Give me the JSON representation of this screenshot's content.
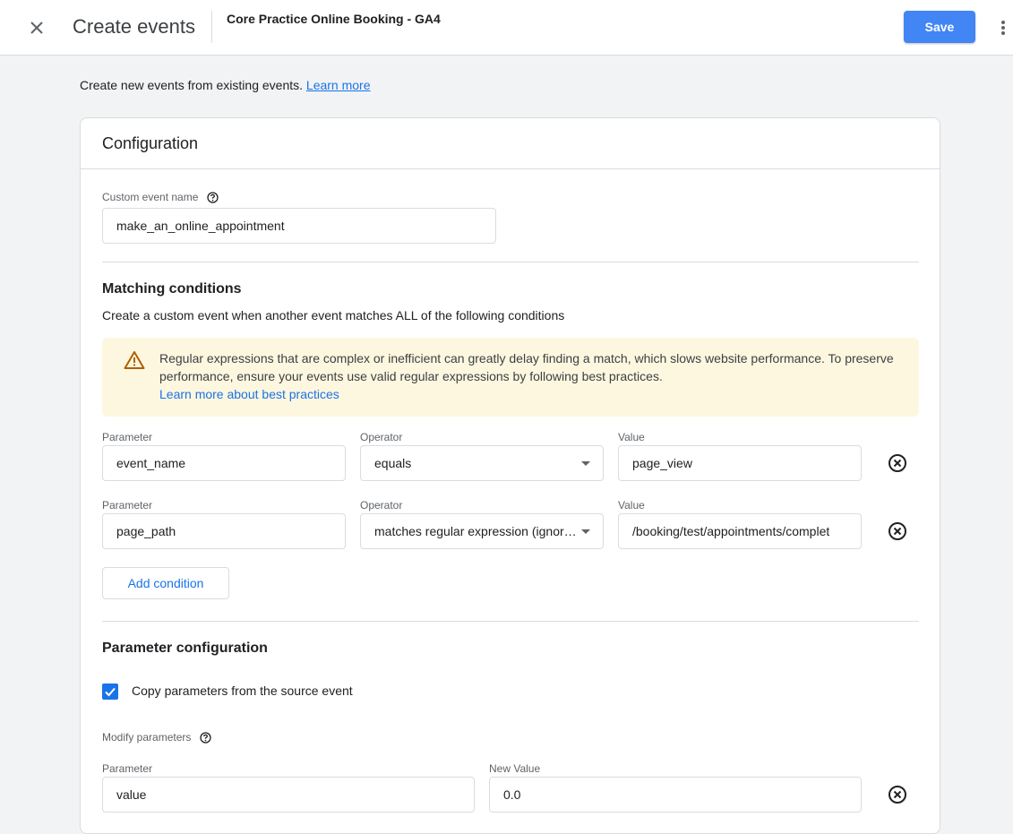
{
  "header": {
    "title": "Create events",
    "property": "Core Practice Online Booking - GA4",
    "save_label": "Save"
  },
  "intro": {
    "text": "Create new events from existing events.",
    "link": "Learn more"
  },
  "configuration": {
    "title": "Configuration",
    "custom_event_name_label": "Custom event name",
    "custom_event_name_value": "make_an_online_appointment"
  },
  "matching": {
    "title": "Matching conditions",
    "description": "Create a custom event when another event matches ALL of the following conditions",
    "warning_text": "Regular expressions that are complex or inefficient can greatly delay finding a match, which slows website performance. To preserve performance, ensure your events use valid regular expressions by following best practices.",
    "warning_link": "Learn more about best practices",
    "conditions": [
      {
        "parameter_label": "Parameter",
        "parameter": "event_name",
        "operator_label": "Operator",
        "operator": "equals",
        "value_label": "Value",
        "value": "page_view"
      },
      {
        "parameter_label": "Parameter",
        "parameter": "page_path",
        "operator_label": "Operator",
        "operator": "matches regular expression (ignore case)",
        "value_label": "Value",
        "value": "/booking/test/appointments/complet"
      }
    ],
    "add_condition_label": "Add condition"
  },
  "parameter_config": {
    "title": "Parameter configuration",
    "copy_label": "Copy parameters from the source event",
    "copy_checked": true,
    "modify_label": "Modify parameters",
    "rows": [
      {
        "parameter_label": "Parameter",
        "parameter": "value",
        "new_value_label": "New Value",
        "new_value": "0.0"
      }
    ]
  },
  "colors": {
    "accent": "#1a73e8",
    "save_button": "#4285f4",
    "warning_bg": "#fef7e0",
    "warning_icon": "#b06000"
  },
  "icons": [
    "close-icon",
    "more-vert-icon",
    "help-icon",
    "warning-icon",
    "remove-circle-icon",
    "check-icon"
  ]
}
